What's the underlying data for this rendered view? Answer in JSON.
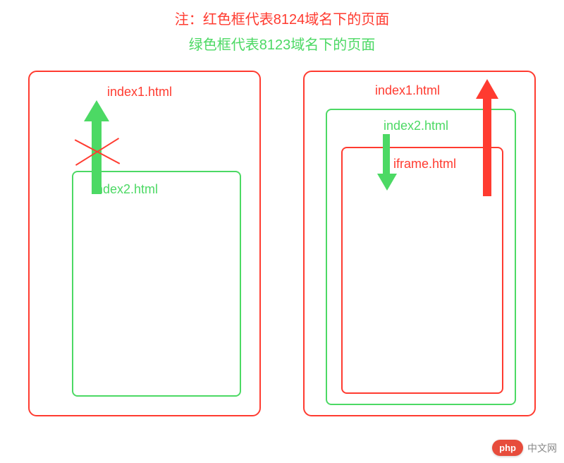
{
  "header": {
    "line1": "注：红色框代表8124域名下的页面",
    "line2": "绿色框代表8123域名下的页面"
  },
  "left": {
    "outer_label": "index1.html",
    "inner_label": "index2.html"
  },
  "right": {
    "outer_label": "index1.html",
    "mid_label": "index2.html",
    "inner_label": "iframe.html"
  },
  "watermark": {
    "badge": "php",
    "text": "中文网"
  },
  "colors": {
    "red": "#ff3b30",
    "green": "#4cd964"
  }
}
